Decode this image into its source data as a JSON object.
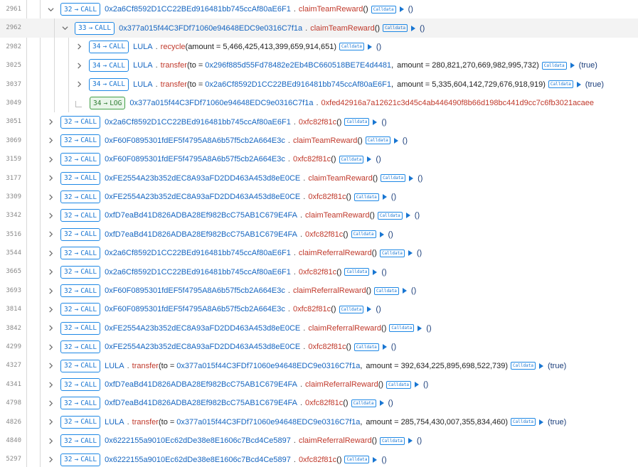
{
  "labels": {
    "calldata": "Calldata",
    "call": "CALL",
    "log": "LOG",
    "arrow": "→"
  },
  "rows": [
    {
      "line": "2961",
      "expanded": true,
      "indent": 0,
      "selected": false,
      "kind": "call",
      "depth": "32",
      "target": "0x2a6Cf8592D1CC22BEd916481bb745ccAf80aE6F1",
      "method": "claimTeamReward",
      "args": [],
      "ret": "()"
    },
    {
      "line": "2962",
      "expanded": true,
      "indent": 1,
      "selected": true,
      "kind": "call",
      "depth": "33",
      "target": "0x377a015f44C3FDf71060e94648EDC9e0316C7f1a",
      "method": "claimTeamReward",
      "args": [],
      "ret": "()"
    },
    {
      "line": "2982",
      "expanded": false,
      "indent": 2,
      "selected": false,
      "kind": "call",
      "depth": "34",
      "target": "LULA",
      "method": "recycle",
      "args": [
        {
          "name": "amount",
          "value": "5,466,425,413,399,659,914,651"
        }
      ],
      "ret": "()"
    },
    {
      "line": "3025",
      "expanded": false,
      "indent": 2,
      "selected": false,
      "kind": "call",
      "depth": "34",
      "target": "LULA",
      "method": "transfer",
      "args": [
        {
          "name": "to",
          "value": "0x296f885d55Fd78482e2Eb4BC660518BE7E4d4481"
        },
        {
          "name": "amount",
          "value": "280,821,270,669,982,995,732"
        }
      ],
      "ret": "(true)"
    },
    {
      "line": "3037",
      "expanded": false,
      "indent": 2,
      "selected": false,
      "kind": "call",
      "depth": "34",
      "target": "LULA",
      "method": "transfer",
      "args": [
        {
          "name": "to",
          "value": "0x2a6Cf8592D1CC22BEd916481bb745ccAf80aE6F1"
        },
        {
          "name": "amount",
          "value": "5,335,604,142,729,676,918,919"
        }
      ],
      "ret": "(true)"
    },
    {
      "line": "3049",
      "expanded": false,
      "indent": 2,
      "selected": false,
      "kind": "log",
      "depth": "34",
      "target": "0x377a015f44C3FDf71060e94648EDC9e0316C7f1a",
      "logdata": "0xfed42916a7a12621c3d45c4ab446490f8b66d198bc441d9cc7c6fb3021acaee"
    },
    {
      "line": "3051",
      "expanded": false,
      "indent": 0,
      "selected": false,
      "kind": "call",
      "depth": "32",
      "target": "0x2a6Cf8592D1CC22BEd916481bb745ccAf80aE6F1",
      "method": "0xfc82f81c",
      "args": [],
      "ret": "()"
    },
    {
      "line": "3069",
      "expanded": false,
      "indent": 0,
      "selected": false,
      "kind": "call",
      "depth": "32",
      "target": "0xF60F0895301fdEF5f4795A8A6b57f5cb2A664E3c",
      "method": "claimTeamReward",
      "args": [],
      "ret": "()"
    },
    {
      "line": "3159",
      "expanded": false,
      "indent": 0,
      "selected": false,
      "kind": "call",
      "depth": "32",
      "target": "0xF60F0895301fdEF5f4795A8A6b57f5cb2A664E3c",
      "method": "0xfc82f81c",
      "args": [],
      "ret": "()"
    },
    {
      "line": "3177",
      "expanded": false,
      "indent": 0,
      "selected": false,
      "kind": "call",
      "depth": "32",
      "target": "0xFE2554A23b352dEC8A93aFD2DD463A453d8eE0CE",
      "method": "claimTeamReward",
      "args": [],
      "ret": "()"
    },
    {
      "line": "3309",
      "expanded": false,
      "indent": 0,
      "selected": false,
      "kind": "call",
      "depth": "32",
      "target": "0xFE2554A23b352dEC8A93aFD2DD463A453d8eE0CE",
      "method": "0xfc82f81c",
      "args": [],
      "ret": "()"
    },
    {
      "line": "3342",
      "expanded": false,
      "indent": 0,
      "selected": false,
      "kind": "call",
      "depth": "32",
      "target": "0xfD7eaBd41D826ADBA28Ef982BcC75AB1C679E4FA",
      "method": "claimTeamReward",
      "args": [],
      "ret": "()"
    },
    {
      "line": "3516",
      "expanded": false,
      "indent": 0,
      "selected": false,
      "kind": "call",
      "depth": "32",
      "target": "0xfD7eaBd41D826ADBA28Ef982BcC75AB1C679E4FA",
      "method": "0xfc82f81c",
      "args": [],
      "ret": "()"
    },
    {
      "line": "3544",
      "expanded": false,
      "indent": 0,
      "selected": false,
      "kind": "call",
      "depth": "32",
      "target": "0x2a6Cf8592D1CC22BEd916481bb745ccAf80aE6F1",
      "method": "claimReferralReward",
      "args": [],
      "ret": "()"
    },
    {
      "line": "3665",
      "expanded": false,
      "indent": 0,
      "selected": false,
      "kind": "call",
      "depth": "32",
      "target": "0x2a6Cf8592D1CC22BEd916481bb745ccAf80aE6F1",
      "method": "0xfc82f81c",
      "args": [],
      "ret": "()"
    },
    {
      "line": "3693",
      "expanded": false,
      "indent": 0,
      "selected": false,
      "kind": "call",
      "depth": "32",
      "target": "0xF60F0895301fdEF5f4795A8A6b57f5cb2A664E3c",
      "method": "claimReferralReward",
      "args": [],
      "ret": "()"
    },
    {
      "line": "3814",
      "expanded": false,
      "indent": 0,
      "selected": false,
      "kind": "call",
      "depth": "32",
      "target": "0xF60F0895301fdEF5f4795A8A6b57f5cb2A664E3c",
      "method": "0xfc82f81c",
      "args": [],
      "ret": "()"
    },
    {
      "line": "3842",
      "expanded": false,
      "indent": 0,
      "selected": false,
      "kind": "call",
      "depth": "32",
      "target": "0xFE2554A23b352dEC8A93aFD2DD463A453d8eE0CE",
      "method": "claimReferralReward",
      "args": [],
      "ret": "()"
    },
    {
      "line": "4299",
      "expanded": false,
      "indent": 0,
      "selected": false,
      "kind": "call",
      "depth": "32",
      "target": "0xFE2554A23b352dEC8A93aFD2DD463A453d8eE0CE",
      "method": "0xfc82f81c",
      "args": [],
      "ret": "()"
    },
    {
      "line": "4327",
      "expanded": false,
      "indent": 0,
      "selected": false,
      "kind": "call",
      "depth": "32",
      "target": "LULA",
      "method": "transfer",
      "args": [
        {
          "name": "to",
          "value": "0x377a015f44C3FDf71060e94648EDC9e0316C7f1a"
        },
        {
          "name": "amount",
          "value": "392,634,225,895,698,522,739"
        }
      ],
      "ret": "(true)"
    },
    {
      "line": "4341",
      "expanded": false,
      "indent": 0,
      "selected": false,
      "kind": "call",
      "depth": "32",
      "target": "0xfD7eaBd41D826ADBA28Ef982BcC75AB1C679E4FA",
      "method": "claimReferralReward",
      "args": [],
      "ret": "()"
    },
    {
      "line": "4798",
      "expanded": false,
      "indent": 0,
      "selected": false,
      "kind": "call",
      "depth": "32",
      "target": "0xfD7eaBd41D826ADBA28Ef982BcC75AB1C679E4FA",
      "method": "0xfc82f81c",
      "args": [],
      "ret": "()"
    },
    {
      "line": "4826",
      "expanded": false,
      "indent": 0,
      "selected": false,
      "kind": "call",
      "depth": "32",
      "target": "LULA",
      "method": "transfer",
      "args": [
        {
          "name": "to",
          "value": "0x377a015f44C3FDf71060e94648EDC9e0316C7f1a"
        },
        {
          "name": "amount",
          "value": "285,754,430,007,355,834,460"
        }
      ],
      "ret": "(true)"
    },
    {
      "line": "4840",
      "expanded": false,
      "indent": 0,
      "selected": false,
      "kind": "call",
      "depth": "32",
      "target": "0x6222155a9010Ec62dDe38e8E1606c7Bcd4Ce5897",
      "method": "claimReferralReward",
      "args": [],
      "ret": "()"
    },
    {
      "line": "5297",
      "expanded": false,
      "indent": 0,
      "selected": false,
      "kind": "call",
      "depth": "32",
      "target": "0x6222155a9010Ec62dDe38e8E1606c7Bcd4Ce5897",
      "method": "0xfc82f81c",
      "args": [],
      "ret": "()"
    }
  ]
}
